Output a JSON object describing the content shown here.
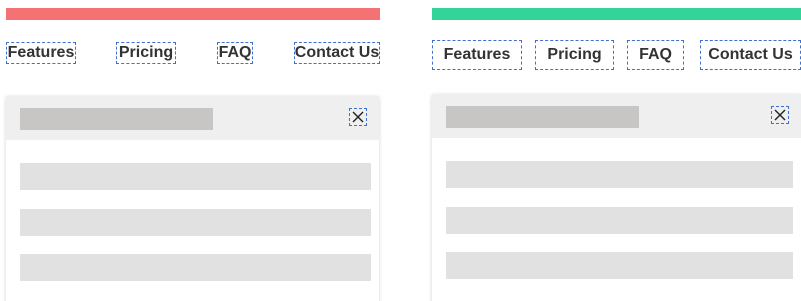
{
  "variants": [
    {
      "accent_color": "#f47174",
      "nav": {
        "features": "Features",
        "pricing": "Pricing",
        "faq": "FAQ",
        "contact": "Contact Us"
      },
      "modal": {
        "close_icon": "close-icon"
      }
    },
    {
      "accent_color": "#34d399",
      "nav": {
        "features": "Features",
        "pricing": "Pricing",
        "faq": "FAQ",
        "contact": "Contact Us"
      },
      "modal": {
        "close_icon": "close-icon"
      }
    }
  ]
}
